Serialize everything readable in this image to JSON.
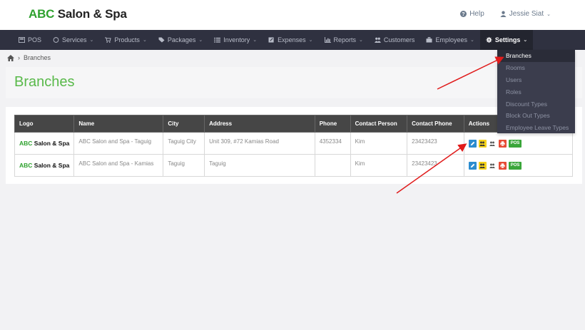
{
  "brand": {
    "abc": "ABC",
    "rest": " Salon & Spa"
  },
  "header": {
    "help_label": "Help",
    "user_name": "Jessie Siat"
  },
  "nav": {
    "items": [
      {
        "label": "POS",
        "icon": "pos-icon"
      },
      {
        "label": "Services",
        "icon": "services-icon"
      },
      {
        "label": "Products",
        "icon": "cart-icon"
      },
      {
        "label": "Packages",
        "icon": "tag-icon"
      },
      {
        "label": "Inventory",
        "icon": "list-icon"
      },
      {
        "label": "Expenses",
        "icon": "edit-icon"
      },
      {
        "label": "Reports",
        "icon": "chart-icon"
      },
      {
        "label": "Customers",
        "icon": "users-icon"
      },
      {
        "label": "Employees",
        "icon": "briefcase-icon"
      },
      {
        "label": "Settings",
        "icon": "gear-icon"
      }
    ]
  },
  "breadcrumb": {
    "current": "Branches"
  },
  "page": {
    "title": "Branches"
  },
  "table": {
    "headers": [
      "Logo",
      "Name",
      "City",
      "Address",
      "Phone",
      "Contact Person",
      "Contact Phone",
      "Actions"
    ],
    "rows": [
      {
        "name": "ABC Salon and Spa - Taguig",
        "city": "Taguig City",
        "address": "Unit 309, #72 Kamias Road",
        "phone": "4352334",
        "contact_person": "Kim",
        "contact_phone": "23423423"
      },
      {
        "name": "ABC Salon and Spa - Kamias",
        "city": "Taguig",
        "address": "Taguig",
        "phone": "",
        "contact_person": "Kim",
        "contact_phone": "23423423"
      }
    ],
    "pos_label": "POS"
  },
  "settings_menu": {
    "items": [
      "Branches",
      "Rooms",
      "Users",
      "Roles",
      "Discount Types",
      "Block Out Types",
      "Employee Leave Types"
    ],
    "selected": "Branches"
  },
  "colors": {
    "brand_green": "#2ea12e",
    "title_green": "#59b94a",
    "nav_bg": "#2f3140",
    "arrow_red": "#e01b1b"
  }
}
